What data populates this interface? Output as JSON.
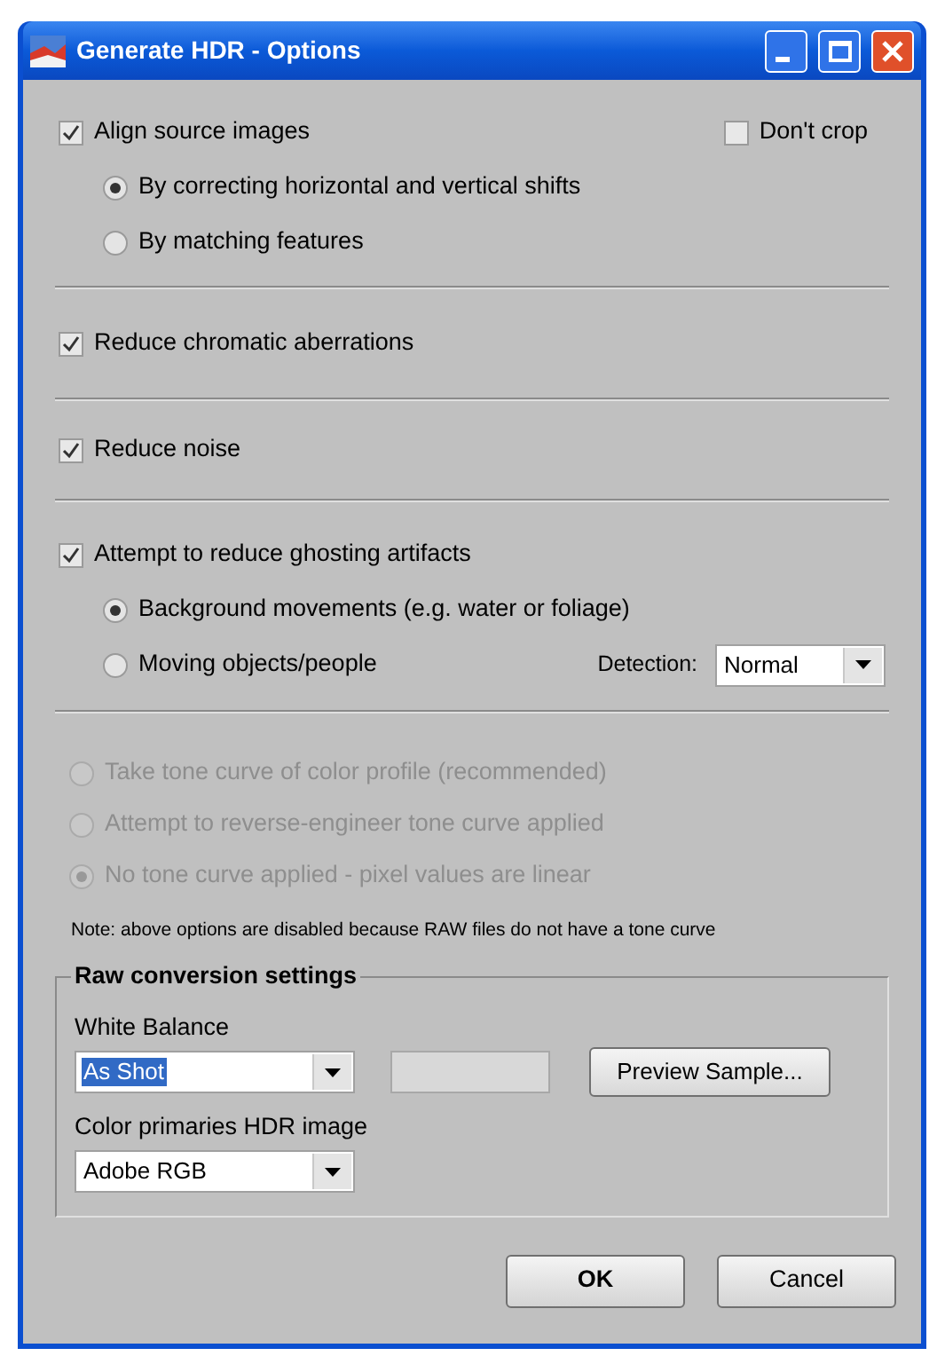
{
  "window": {
    "title": "Generate HDR - Options"
  },
  "align": {
    "label": "Align source images",
    "checked": true,
    "options": [
      {
        "label": "By correcting horizontal and vertical shifts",
        "selected": true
      },
      {
        "label": "By matching features",
        "selected": false
      }
    ],
    "dont_crop": {
      "label": "Don't crop",
      "checked": false
    }
  },
  "chromatic": {
    "label": "Reduce chromatic aberrations",
    "checked": true
  },
  "noise": {
    "label": "Reduce noise",
    "checked": true
  },
  "ghosting": {
    "label": "Attempt to reduce ghosting artifacts",
    "checked": true,
    "options": [
      {
        "label": "Background movements (e.g. water or foliage)",
        "selected": true
      },
      {
        "label": "Moving objects/people",
        "selected": false
      }
    ],
    "detection": {
      "label": "Detection:",
      "value": "Normal"
    }
  },
  "tone_curve": {
    "disabled": true,
    "options": [
      {
        "label": "Take tone curve of color profile (recommended)",
        "selected": false
      },
      {
        "label": "Attempt to reverse-engineer tone curve applied",
        "selected": false
      },
      {
        "label": "No tone curve applied - pixel values are linear",
        "selected": true
      }
    ],
    "note": "Note: above options are disabled because RAW files do not have a tone curve"
  },
  "raw_conversion": {
    "title": "Raw conversion settings",
    "white_balance": {
      "label": "White Balance",
      "value": "As Shot",
      "highlighted": true
    },
    "preview_button": "Preview Sample...",
    "color_primaries": {
      "label": "Color primaries HDR image",
      "value": "Adobe RGB",
      "highlighted": false
    }
  },
  "buttons": [
    {
      "label": "OK",
      "default": true
    },
    {
      "label": "Cancel",
      "default": false
    }
  ]
}
